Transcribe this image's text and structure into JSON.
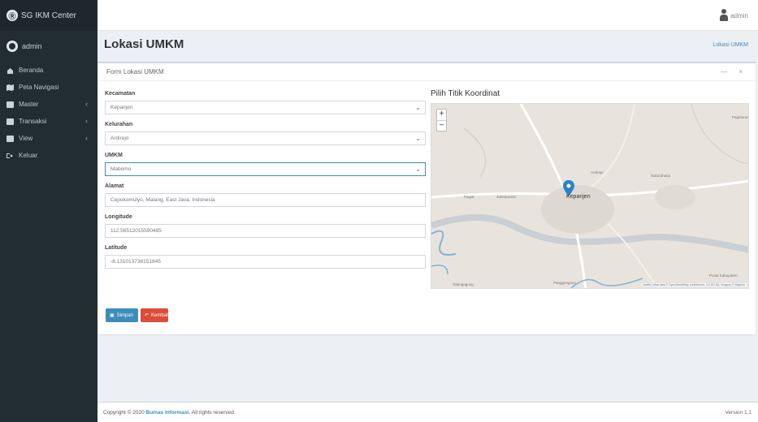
{
  "app": {
    "brand": "SG IKM Center",
    "user": "admin",
    "top_user": "admin"
  },
  "sidebar": {
    "items": [
      {
        "label": "Beranda",
        "icon": "dashboard-icon",
        "chevron": ""
      },
      {
        "label": "Peta Navigasi",
        "icon": "map-icon",
        "chevron": ""
      },
      {
        "label": "Master",
        "icon": "file-icon",
        "chevron": "‹"
      },
      {
        "label": "Transaksi",
        "icon": "file-icon",
        "chevron": "‹"
      },
      {
        "label": "View",
        "icon": "file-icon",
        "chevron": "‹"
      },
      {
        "label": "Keluar",
        "icon": "sign-out-icon",
        "chevron": ""
      }
    ]
  },
  "header": {
    "title": "Lokasi UMKM",
    "breadcrumb": "Lokasi UMKM"
  },
  "box": {
    "title": "Form Lokasi UMKM",
    "tools": "—  ×",
    "fields": {
      "kecamatan": {
        "label": "Kecamatan",
        "value": "Kepanjen"
      },
      "kelurahan": {
        "label": "Kelurahan",
        "value": "Ardirejo"
      },
      "umkm": {
        "label": "UMKM",
        "value": "Mabomo"
      },
      "alamat": {
        "label": "Alamat",
        "value": "Cepokomulyo, Malang, East Java, Indonesia"
      },
      "longitude": {
        "label": "Longitude",
        "value": "112.56512015590485"
      },
      "latitude": {
        "label": "Latitude",
        "value": "-8.131013736151845"
      }
    },
    "map": {
      "title": "Pilih Titik Koordinat",
      "zoom_in": "+",
      "zoom_out": "−",
      "town": "Kepanjen",
      "places": [
        "Sukoraharjo",
        "Jatirejoyoso",
        "Ardirejo",
        "Talangagung",
        "Panggungrejo",
        "Pagak",
        "Pagelaran",
        "Pusat Kabupaten"
      ],
      "attribution": "Leaflet | Map data © OpenStreetMap contributors, CC-BY-SA, Imagery © Mapbox"
    },
    "buttons": {
      "save": "Simpan",
      "back": "Kembali"
    }
  },
  "footer": {
    "copyright_prefix": "Copyright © 2020",
    "company": "Bumas Informasi.",
    "rights": "All rights reserved.",
    "version": "Version 1.1"
  },
  "colors": {
    "sidebar": "#222d32",
    "primary": "#3c8dbc",
    "danger": "#dd4b39",
    "marker": "#2a81cb"
  }
}
